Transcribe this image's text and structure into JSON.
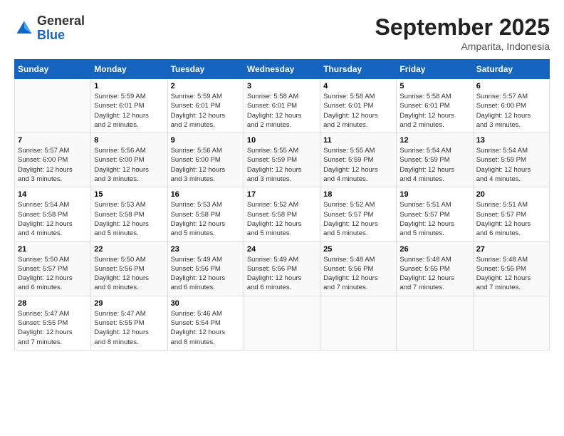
{
  "header": {
    "logo_general": "General",
    "logo_blue": "Blue",
    "month_title": "September 2025",
    "location": "Amparita, Indonesia"
  },
  "weekdays": [
    "Sunday",
    "Monday",
    "Tuesday",
    "Wednesday",
    "Thursday",
    "Friday",
    "Saturday"
  ],
  "weeks": [
    [
      {
        "day": "",
        "info": ""
      },
      {
        "day": "1",
        "info": "Sunrise: 5:59 AM\nSunset: 6:01 PM\nDaylight: 12 hours\nand 2 minutes."
      },
      {
        "day": "2",
        "info": "Sunrise: 5:59 AM\nSunset: 6:01 PM\nDaylight: 12 hours\nand 2 minutes."
      },
      {
        "day": "3",
        "info": "Sunrise: 5:58 AM\nSunset: 6:01 PM\nDaylight: 12 hours\nand 2 minutes."
      },
      {
        "day": "4",
        "info": "Sunrise: 5:58 AM\nSunset: 6:01 PM\nDaylight: 12 hours\nand 2 minutes."
      },
      {
        "day": "5",
        "info": "Sunrise: 5:58 AM\nSunset: 6:01 PM\nDaylight: 12 hours\nand 2 minutes."
      },
      {
        "day": "6",
        "info": "Sunrise: 5:57 AM\nSunset: 6:00 PM\nDaylight: 12 hours\nand 3 minutes."
      }
    ],
    [
      {
        "day": "7",
        "info": "Sunrise: 5:57 AM\nSunset: 6:00 PM\nDaylight: 12 hours\nand 3 minutes."
      },
      {
        "day": "8",
        "info": "Sunrise: 5:56 AM\nSunset: 6:00 PM\nDaylight: 12 hours\nand 3 minutes."
      },
      {
        "day": "9",
        "info": "Sunrise: 5:56 AM\nSunset: 6:00 PM\nDaylight: 12 hours\nand 3 minutes."
      },
      {
        "day": "10",
        "info": "Sunrise: 5:55 AM\nSunset: 5:59 PM\nDaylight: 12 hours\nand 3 minutes."
      },
      {
        "day": "11",
        "info": "Sunrise: 5:55 AM\nSunset: 5:59 PM\nDaylight: 12 hours\nand 4 minutes."
      },
      {
        "day": "12",
        "info": "Sunrise: 5:54 AM\nSunset: 5:59 PM\nDaylight: 12 hours\nand 4 minutes."
      },
      {
        "day": "13",
        "info": "Sunrise: 5:54 AM\nSunset: 5:59 PM\nDaylight: 12 hours\nand 4 minutes."
      }
    ],
    [
      {
        "day": "14",
        "info": "Sunrise: 5:54 AM\nSunset: 5:58 PM\nDaylight: 12 hours\nand 4 minutes."
      },
      {
        "day": "15",
        "info": "Sunrise: 5:53 AM\nSunset: 5:58 PM\nDaylight: 12 hours\nand 5 minutes."
      },
      {
        "day": "16",
        "info": "Sunrise: 5:53 AM\nSunset: 5:58 PM\nDaylight: 12 hours\nand 5 minutes."
      },
      {
        "day": "17",
        "info": "Sunrise: 5:52 AM\nSunset: 5:58 PM\nDaylight: 12 hours\nand 5 minutes."
      },
      {
        "day": "18",
        "info": "Sunrise: 5:52 AM\nSunset: 5:57 PM\nDaylight: 12 hours\nand 5 minutes."
      },
      {
        "day": "19",
        "info": "Sunrise: 5:51 AM\nSunset: 5:57 PM\nDaylight: 12 hours\nand 5 minutes."
      },
      {
        "day": "20",
        "info": "Sunrise: 5:51 AM\nSunset: 5:57 PM\nDaylight: 12 hours\nand 6 minutes."
      }
    ],
    [
      {
        "day": "21",
        "info": "Sunrise: 5:50 AM\nSunset: 5:57 PM\nDaylight: 12 hours\nand 6 minutes."
      },
      {
        "day": "22",
        "info": "Sunrise: 5:50 AM\nSunset: 5:56 PM\nDaylight: 12 hours\nand 6 minutes."
      },
      {
        "day": "23",
        "info": "Sunrise: 5:49 AM\nSunset: 5:56 PM\nDaylight: 12 hours\nand 6 minutes."
      },
      {
        "day": "24",
        "info": "Sunrise: 5:49 AM\nSunset: 5:56 PM\nDaylight: 12 hours\nand 6 minutes."
      },
      {
        "day": "25",
        "info": "Sunrise: 5:48 AM\nSunset: 5:56 PM\nDaylight: 12 hours\nand 7 minutes."
      },
      {
        "day": "26",
        "info": "Sunrise: 5:48 AM\nSunset: 5:55 PM\nDaylight: 12 hours\nand 7 minutes."
      },
      {
        "day": "27",
        "info": "Sunrise: 5:48 AM\nSunset: 5:55 PM\nDaylight: 12 hours\nand 7 minutes."
      }
    ],
    [
      {
        "day": "28",
        "info": "Sunrise: 5:47 AM\nSunset: 5:55 PM\nDaylight: 12 hours\nand 7 minutes."
      },
      {
        "day": "29",
        "info": "Sunrise: 5:47 AM\nSunset: 5:55 PM\nDaylight: 12 hours\nand 8 minutes."
      },
      {
        "day": "30",
        "info": "Sunrise: 5:46 AM\nSunset: 5:54 PM\nDaylight: 12 hours\nand 8 minutes."
      },
      {
        "day": "",
        "info": ""
      },
      {
        "day": "",
        "info": ""
      },
      {
        "day": "",
        "info": ""
      },
      {
        "day": "",
        "info": ""
      }
    ]
  ]
}
